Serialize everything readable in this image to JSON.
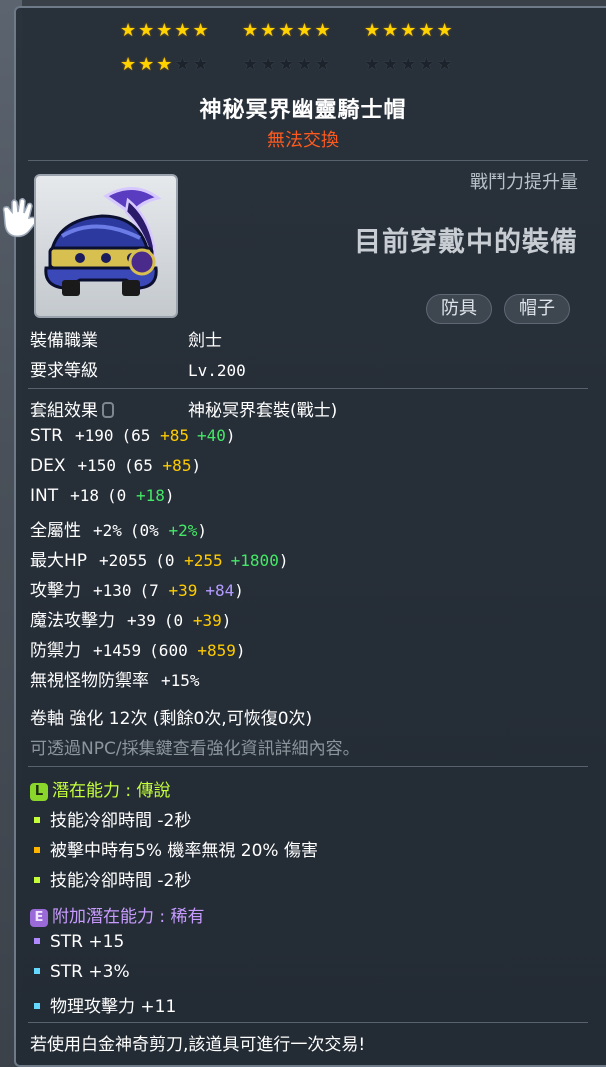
{
  "stars": {
    "filled": 18,
    "total": 30
  },
  "item": {
    "name": "神秘冥界幽靈騎士帽",
    "trade_status": "無法交換",
    "icon": "helmet-icon"
  },
  "comparison": {
    "header": "戰鬥力提升量",
    "status": "目前穿戴中的裝備"
  },
  "tags": [
    "防具",
    "帽子"
  ],
  "requirements": {
    "job_label": "裝備職業",
    "job_value": "劍士",
    "level_label": "要求等級",
    "level_value": "Lv.200"
  },
  "set": {
    "label": "套組效果",
    "value": "神秘冥界套裝(戰士)"
  },
  "stats": [
    {
      "name": "STR",
      "total": "+190",
      "open": "(65 ",
      "parts": [
        {
          "v": "+85",
          "c": "yellow"
        },
        {
          "v": "+40",
          "c": "green"
        }
      ],
      "close": ")"
    },
    {
      "name": "DEX",
      "total": "+150",
      "open": "(65 ",
      "parts": [
        {
          "v": "+85",
          "c": "yellow"
        }
      ],
      "close": ")"
    },
    {
      "name": "INT",
      "total": "+18",
      "open": "(0 ",
      "parts": [
        {
          "v": "+18",
          "c": "green"
        }
      ],
      "close": ")"
    },
    {
      "name": "全屬性",
      "total": "+2%",
      "open": "(0% ",
      "parts": [
        {
          "v": "+2%",
          "c": "green"
        }
      ],
      "close": ")"
    },
    {
      "name": "最大HP",
      "total": "+2055",
      "open": "(0 ",
      "parts": [
        {
          "v": "+255",
          "c": "yellow"
        },
        {
          "v": "+1800",
          "c": "green"
        }
      ],
      "close": ")"
    },
    {
      "name": "攻擊力",
      "total": "+130",
      "open": "(7 ",
      "parts": [
        {
          "v": "+39",
          "c": "yellow"
        },
        {
          "v": "+84",
          "c": "purple"
        }
      ],
      "close": ")"
    },
    {
      "name": "魔法攻擊力",
      "total": "+39",
      "open": "(0 ",
      "parts": [
        {
          "v": "+39",
          "c": "yellow"
        }
      ],
      "close": ")"
    },
    {
      "name": "防禦力",
      "total": "+1459",
      "open": "(600 ",
      "parts": [
        {
          "v": "+859",
          "c": "yellow"
        }
      ],
      "close": ")"
    },
    {
      "name": "無視怪物防禦率",
      "total": "+15%",
      "open": "",
      "parts": [],
      "close": ""
    }
  ],
  "scroll": {
    "text": "卷軸 強化 12次 (剩餘0次,可恢復0次)",
    "hint": "可透過NPC/採集鍵查看強化資訊詳細內容。"
  },
  "potential": {
    "badge": "L",
    "title": "潛在能力 : 傳說",
    "color": "#c4ff3a",
    "lines": [
      {
        "text": "技能冷卻時間 -2秒",
        "bullet_color": "#c4ff3a"
      },
      {
        "text": "被擊中時有5% 機率無視 20% 傷害",
        "bullet_color": "#ffb400"
      },
      {
        "text": "技能冷卻時間 -2秒",
        "bullet_color": "#c4ff3a"
      }
    ]
  },
  "additional_potential": {
    "badge": "E",
    "title": "附加潛在能力 : 稀有",
    "color": "#c89cff",
    "lines": [
      {
        "text": "STR +15",
        "bullet_color": "#b088ff"
      },
      {
        "text": "STR +3%",
        "bullet_color": "#64d8ff"
      },
      {
        "text": "物理攻擊力 +11",
        "bullet_color": "#64d8ff"
      }
    ]
  },
  "footer": "若使用白金神奇剪刀,該道具可進行一次交易!"
}
